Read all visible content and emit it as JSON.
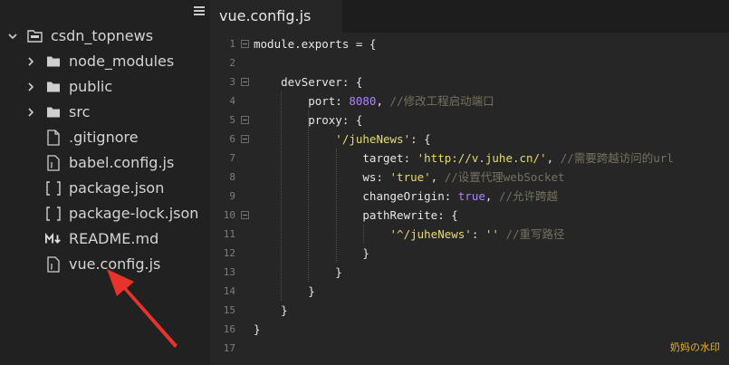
{
  "sidebar": {
    "menu_icon": "hamburger-icon",
    "root": {
      "label": "csdn_topnews",
      "icon": "folder-open-icon"
    },
    "items": [
      {
        "label": "node_modules",
        "type": "folder"
      },
      {
        "label": "public",
        "type": "folder"
      },
      {
        "label": "src",
        "type": "folder"
      },
      {
        "label": ".gitignore",
        "type": "file"
      },
      {
        "label": "babel.config.js",
        "type": "js"
      },
      {
        "label": "package.json",
        "type": "json"
      },
      {
        "label": "package-lock.json",
        "type": "json"
      },
      {
        "label": "README.md",
        "type": "markdown"
      },
      {
        "label": "vue.config.js",
        "type": "js"
      }
    ]
  },
  "editor": {
    "tab_label": "vue.config.js",
    "lines": [
      {
        "n": "1",
        "fold": true,
        "tokens": [
          [
            "tok-key",
            "module.exports = {"
          ]
        ]
      },
      {
        "n": "2",
        "fold": false,
        "tokens": []
      },
      {
        "n": "3",
        "fold": true,
        "tokens": [
          [
            "tok-key",
            "    devServer: {"
          ]
        ]
      },
      {
        "n": "4",
        "fold": false,
        "tokens": [
          [
            "tok-key",
            "        port: "
          ],
          [
            "tok-num",
            "8080"
          ],
          [
            "tok-punc",
            ", "
          ],
          [
            "tok-com",
            "//修改工程启动端口"
          ]
        ]
      },
      {
        "n": "5",
        "fold": true,
        "tokens": [
          [
            "tok-key",
            "        proxy: {"
          ]
        ]
      },
      {
        "n": "6",
        "fold": true,
        "tokens": [
          [
            "tok-str",
            "            '/juheNews'"
          ],
          [
            "tok-punc",
            ": {"
          ]
        ]
      },
      {
        "n": "7",
        "fold": false,
        "tokens": [
          [
            "tok-key",
            "                target: "
          ],
          [
            "tok-str",
            "'http://v.juhe.cn/'"
          ],
          [
            "tok-punc",
            ", "
          ],
          [
            "tok-com",
            "//需要跨越访问的url"
          ]
        ]
      },
      {
        "n": "8",
        "fold": false,
        "tokens": [
          [
            "tok-key",
            "                ws: "
          ],
          [
            "tok-str",
            "'true'"
          ],
          [
            "tok-punc",
            ", "
          ],
          [
            "tok-com",
            "//设置代理webSocket"
          ]
        ]
      },
      {
        "n": "9",
        "fold": false,
        "tokens": [
          [
            "tok-key",
            "                changeOrigin: "
          ],
          [
            "tok-bool",
            "true"
          ],
          [
            "tok-punc",
            ", "
          ],
          [
            "tok-com",
            "//允许跨越"
          ]
        ]
      },
      {
        "n": "10",
        "fold": true,
        "tokens": [
          [
            "tok-key",
            "                pathRewrite: {"
          ]
        ]
      },
      {
        "n": "11",
        "fold": false,
        "tokens": [
          [
            "tok-str",
            "                    '^/juheNews'"
          ],
          [
            "tok-punc",
            ": "
          ],
          [
            "tok-str",
            "''"
          ],
          [
            "tok-punc",
            " "
          ],
          [
            "tok-com",
            "//重写路径"
          ]
        ]
      },
      {
        "n": "12",
        "fold": false,
        "tokens": [
          [
            "tok-key",
            "                }"
          ]
        ]
      },
      {
        "n": "13",
        "fold": false,
        "tokens": [
          [
            "tok-key",
            "            }"
          ]
        ]
      },
      {
        "n": "14",
        "fold": false,
        "tokens": [
          [
            "tok-key",
            "        }"
          ]
        ]
      },
      {
        "n": "15",
        "fold": false,
        "tokens": [
          [
            "tok-key",
            "    }"
          ]
        ]
      },
      {
        "n": "16",
        "fold": false,
        "tokens": [
          [
            "tok-key",
            "}"
          ]
        ]
      },
      {
        "n": "17",
        "fold": false,
        "tokens": []
      }
    ]
  },
  "watermark": "奶妈の水印",
  "colors": {
    "sidebar_bg": "#212121",
    "editor_bg": "#262626",
    "string": "#e6db74",
    "number": "#ae81ff",
    "comment": "#75715e",
    "arrow": "#e8322c",
    "watermark": "#e6b422"
  }
}
